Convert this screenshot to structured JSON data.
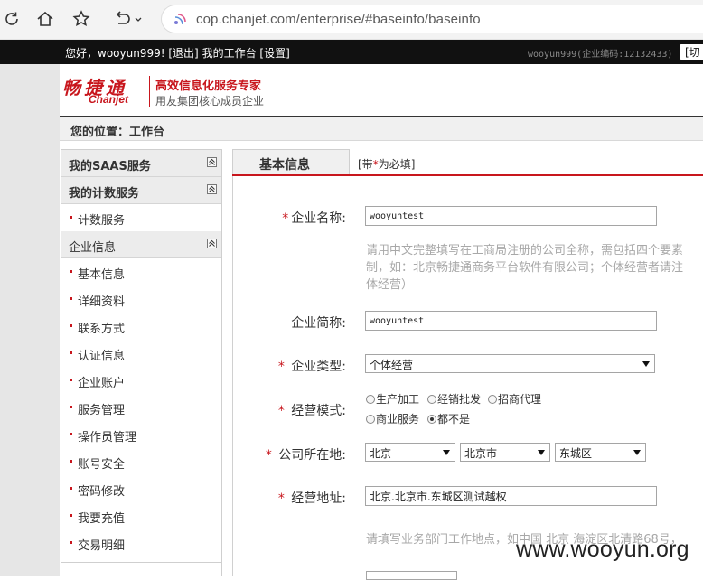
{
  "browser": {
    "url": "cop.chanjet.com/enterprise/#baseinfo/baseinfo"
  },
  "topbar": {
    "greeting": "您好，wooyun999!",
    "logout": "[退出]",
    "workbench": "我的工作台",
    "settings": "[设置]",
    "user_code": "wooyun999(企业编码:12132433)",
    "switch": "[切"
  },
  "header": {
    "logo_cn": "畅捷通",
    "logo_en": "Chanjet",
    "slogan_main": "高效信息化服务专家",
    "slogan_sub": "用友集团核心成员企业"
  },
  "breadcrumb": "您的位置：工作台",
  "sidebar": {
    "saas": "我的SAAS服务",
    "metered": "我的计数服务",
    "metered_items": [
      "计数服务"
    ],
    "enterprise": "企业信息",
    "enterprise_items": [
      "基本信息",
      "详细资料",
      "联系方式",
      "认证信息",
      "企业账户",
      "服务管理",
      "操作员管理",
      "账号安全",
      "密码修改",
      "我要充值",
      "交易明细"
    ]
  },
  "tab": {
    "active": "基本信息",
    "note_prefix": "[带",
    "note_star": "*",
    "note_suffix": "为必填]"
  },
  "form": {
    "name_label": "企业名称:",
    "name_value": "wooyuntest",
    "name_hint": [
      "请用中文完整填写在工商局注册的公司全称，需包括四个要素",
      "制，如：北京畅捷通商务平台软件有限公司；个体经营者请注",
      "体经营）"
    ],
    "short_label": "企业简称:",
    "short_value": "wooyuntest",
    "type_label": "企业类型:",
    "type_value": "个体经营",
    "mode_label": "经营模式:",
    "mode_options": [
      "生产加工",
      "经销批发",
      "招商代理",
      "商业服务",
      "都不是"
    ],
    "mode_selected": "都不是",
    "location_label": "公司所在地:",
    "province": "北京",
    "city": "北京市",
    "district": "东城区",
    "address_label": "经营地址:",
    "address_value": "北京.北京市.东城区测试越权",
    "address_hint": "请填写业务部门工作地点，如中国 北京 海淀区北清路68号，"
  },
  "watermark": "www.wooyun.org"
}
